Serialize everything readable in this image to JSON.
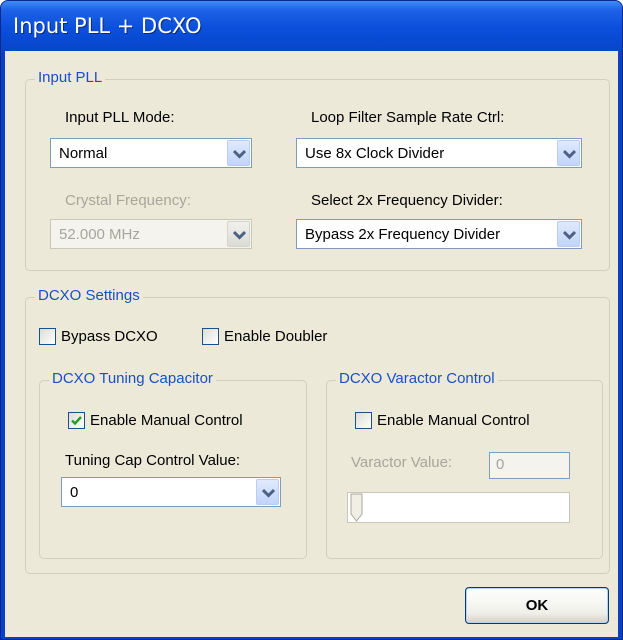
{
  "window": {
    "title": "Input PLL + DCXO"
  },
  "input_pll": {
    "legend": "Input PLL",
    "mode_label": "Input PLL Mode:",
    "mode_value": "Normal",
    "crystal_label": "Crystal Frequency:",
    "crystal_value": "52.000 MHz",
    "loop_filter_label": "Loop Filter Sample Rate Ctrl:",
    "loop_filter_value": "Use 8x Clock Divider",
    "divider_label": "Select 2x Frequency Divider:",
    "divider_value": "Bypass 2x Frequency Divider"
  },
  "dcxo": {
    "legend": "DCXO Settings",
    "bypass_label": "Bypass DCXO",
    "bypass_checked": false,
    "doubler_label": "Enable Doubler",
    "doubler_checked": false,
    "tuning": {
      "legend": "DCXO Tuning Capacitor",
      "manual_label": "Enable Manual Control",
      "manual_checked": true,
      "cap_label": "Tuning Cap Control Value:",
      "cap_value": "0"
    },
    "varactor": {
      "legend": "DCXO Varactor Control",
      "manual_label": "Enable Manual Control",
      "manual_checked": false,
      "value_label": "Varactor Value:",
      "value": "0",
      "slider_level": 0
    }
  },
  "buttons": {
    "ok_label": "OK"
  },
  "colors": {
    "title_bar": "#0a4fdc",
    "group_text": "#1a4fc8",
    "dialog_bg": "#ece9d8",
    "check_mark": "#21a121"
  }
}
